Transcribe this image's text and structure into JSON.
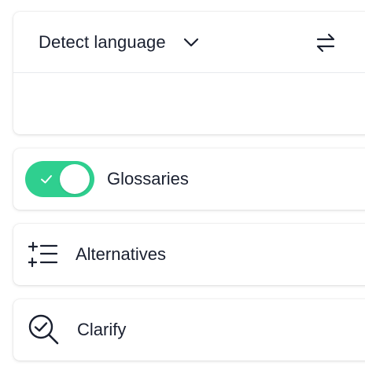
{
  "source": {
    "language_label": "Detect language",
    "language_icon": "chevron-down-icon",
    "swap_icon": "swap-icon",
    "text": ""
  },
  "features": {
    "glossaries": {
      "label": "Glossaries",
      "enabled": true,
      "toggle_color": "#2fcf8f",
      "icon": "check-icon"
    },
    "alternatives": {
      "label": "Alternatives",
      "icon": "sparkle-list-icon"
    },
    "clarify": {
      "label": "Clarify",
      "icon": "search-check-icon"
    }
  },
  "colors": {
    "text": "#1a2030",
    "accent": "#2fcf8f",
    "divider": "#e7e9ee"
  }
}
